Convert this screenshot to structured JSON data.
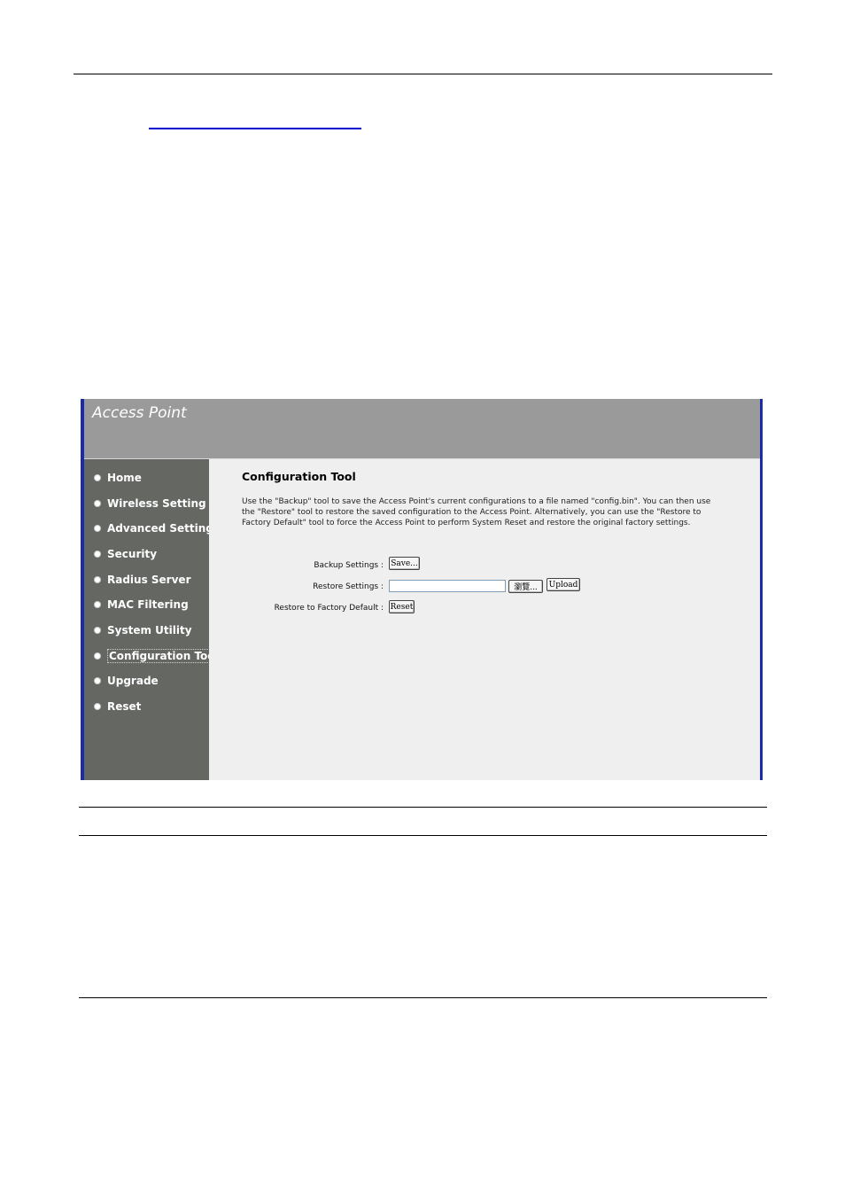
{
  "app": {
    "title": "Access Point"
  },
  "sidebar": {
    "items": [
      {
        "label": "Home"
      },
      {
        "label": "Wireless Setting"
      },
      {
        "label": "Advanced Setting"
      },
      {
        "label": "Security"
      },
      {
        "label": "Radius Server"
      },
      {
        "label": "MAC Filtering"
      },
      {
        "label": "System Utility"
      },
      {
        "label": "Configuration Tool",
        "active": true
      },
      {
        "label": "Upgrade"
      },
      {
        "label": "Reset"
      }
    ]
  },
  "main": {
    "title": "Configuration Tool",
    "description": "Use the \"Backup\" tool to save the Access Point's current configurations to a file named \"config.bin\". You can then use the \"Restore\" tool to restore the saved configuration to the Access Point. Alternatively, you can use the \"Restore to Factory Default\" tool to force the Access Point to perform System Reset and restore the original factory settings.",
    "backup": {
      "label": "Backup Settings :",
      "button": "Save..."
    },
    "restore": {
      "label": "Restore Settings :",
      "input_value": "",
      "browse_button": "瀏覽...",
      "upload_button": "Upload"
    },
    "factory": {
      "label": "Restore to Factory Default :",
      "button": "Reset"
    }
  },
  "colors": {
    "frame_border": "#1a2ca8",
    "header_bg": "#9b9a9b",
    "sidebar_bg": "#656763",
    "content_bg": "#efefef"
  }
}
